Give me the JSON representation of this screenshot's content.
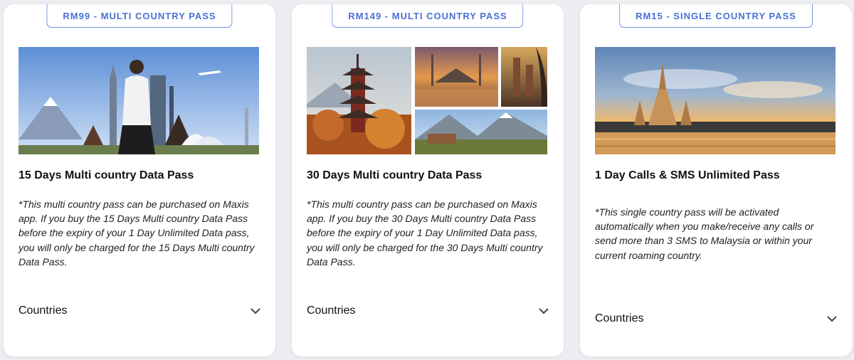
{
  "cards": [
    {
      "badge": "RM99 - MULTI COUNTRY PASS",
      "title": "15 Days Multi country Data Pass",
      "note": "*This multi country pass can be purchased on Maxis app. If you buy the 15 Days Multi country Data Pass before the expiry of your 1 Day Unlimited Data pass, you will only be charged for the 15 Days Multi country Data Pass.",
      "countries_label": "Countries",
      "image": "traveler-landmarks-collage"
    },
    {
      "badge": "RM149 - MULTI COUNTRY PASS",
      "title": "30 Days Multi country Data Pass",
      "note": "*This multi country pass can be purchased on Maxis app. If you buy the 30 Days Multi country Data Pass before the expiry of your 1 Day Unlimited Data pass, you will only be charged for the 30 Days Multi country Data Pass.",
      "countries_label": "Countries",
      "image": "pagoda-mosque-cathedral-mountains-collage"
    },
    {
      "badge": "RM15 - SINGLE COUNTRY PASS",
      "title": "1 Day Calls & SMS Unlimited Pass",
      "note": "*This single country pass will be activated automatically when you make/receive any calls or send more than 3 SMS to Malaysia or within your current roaming country.",
      "countries_label": "Countries",
      "image": "temple-river-sunset"
    }
  ],
  "colors": {
    "background": "#eceef2",
    "card": "#ffffff",
    "badge_border": "#6d8fe0",
    "badge_text": "#4a6fd6",
    "title_text": "#111111"
  }
}
